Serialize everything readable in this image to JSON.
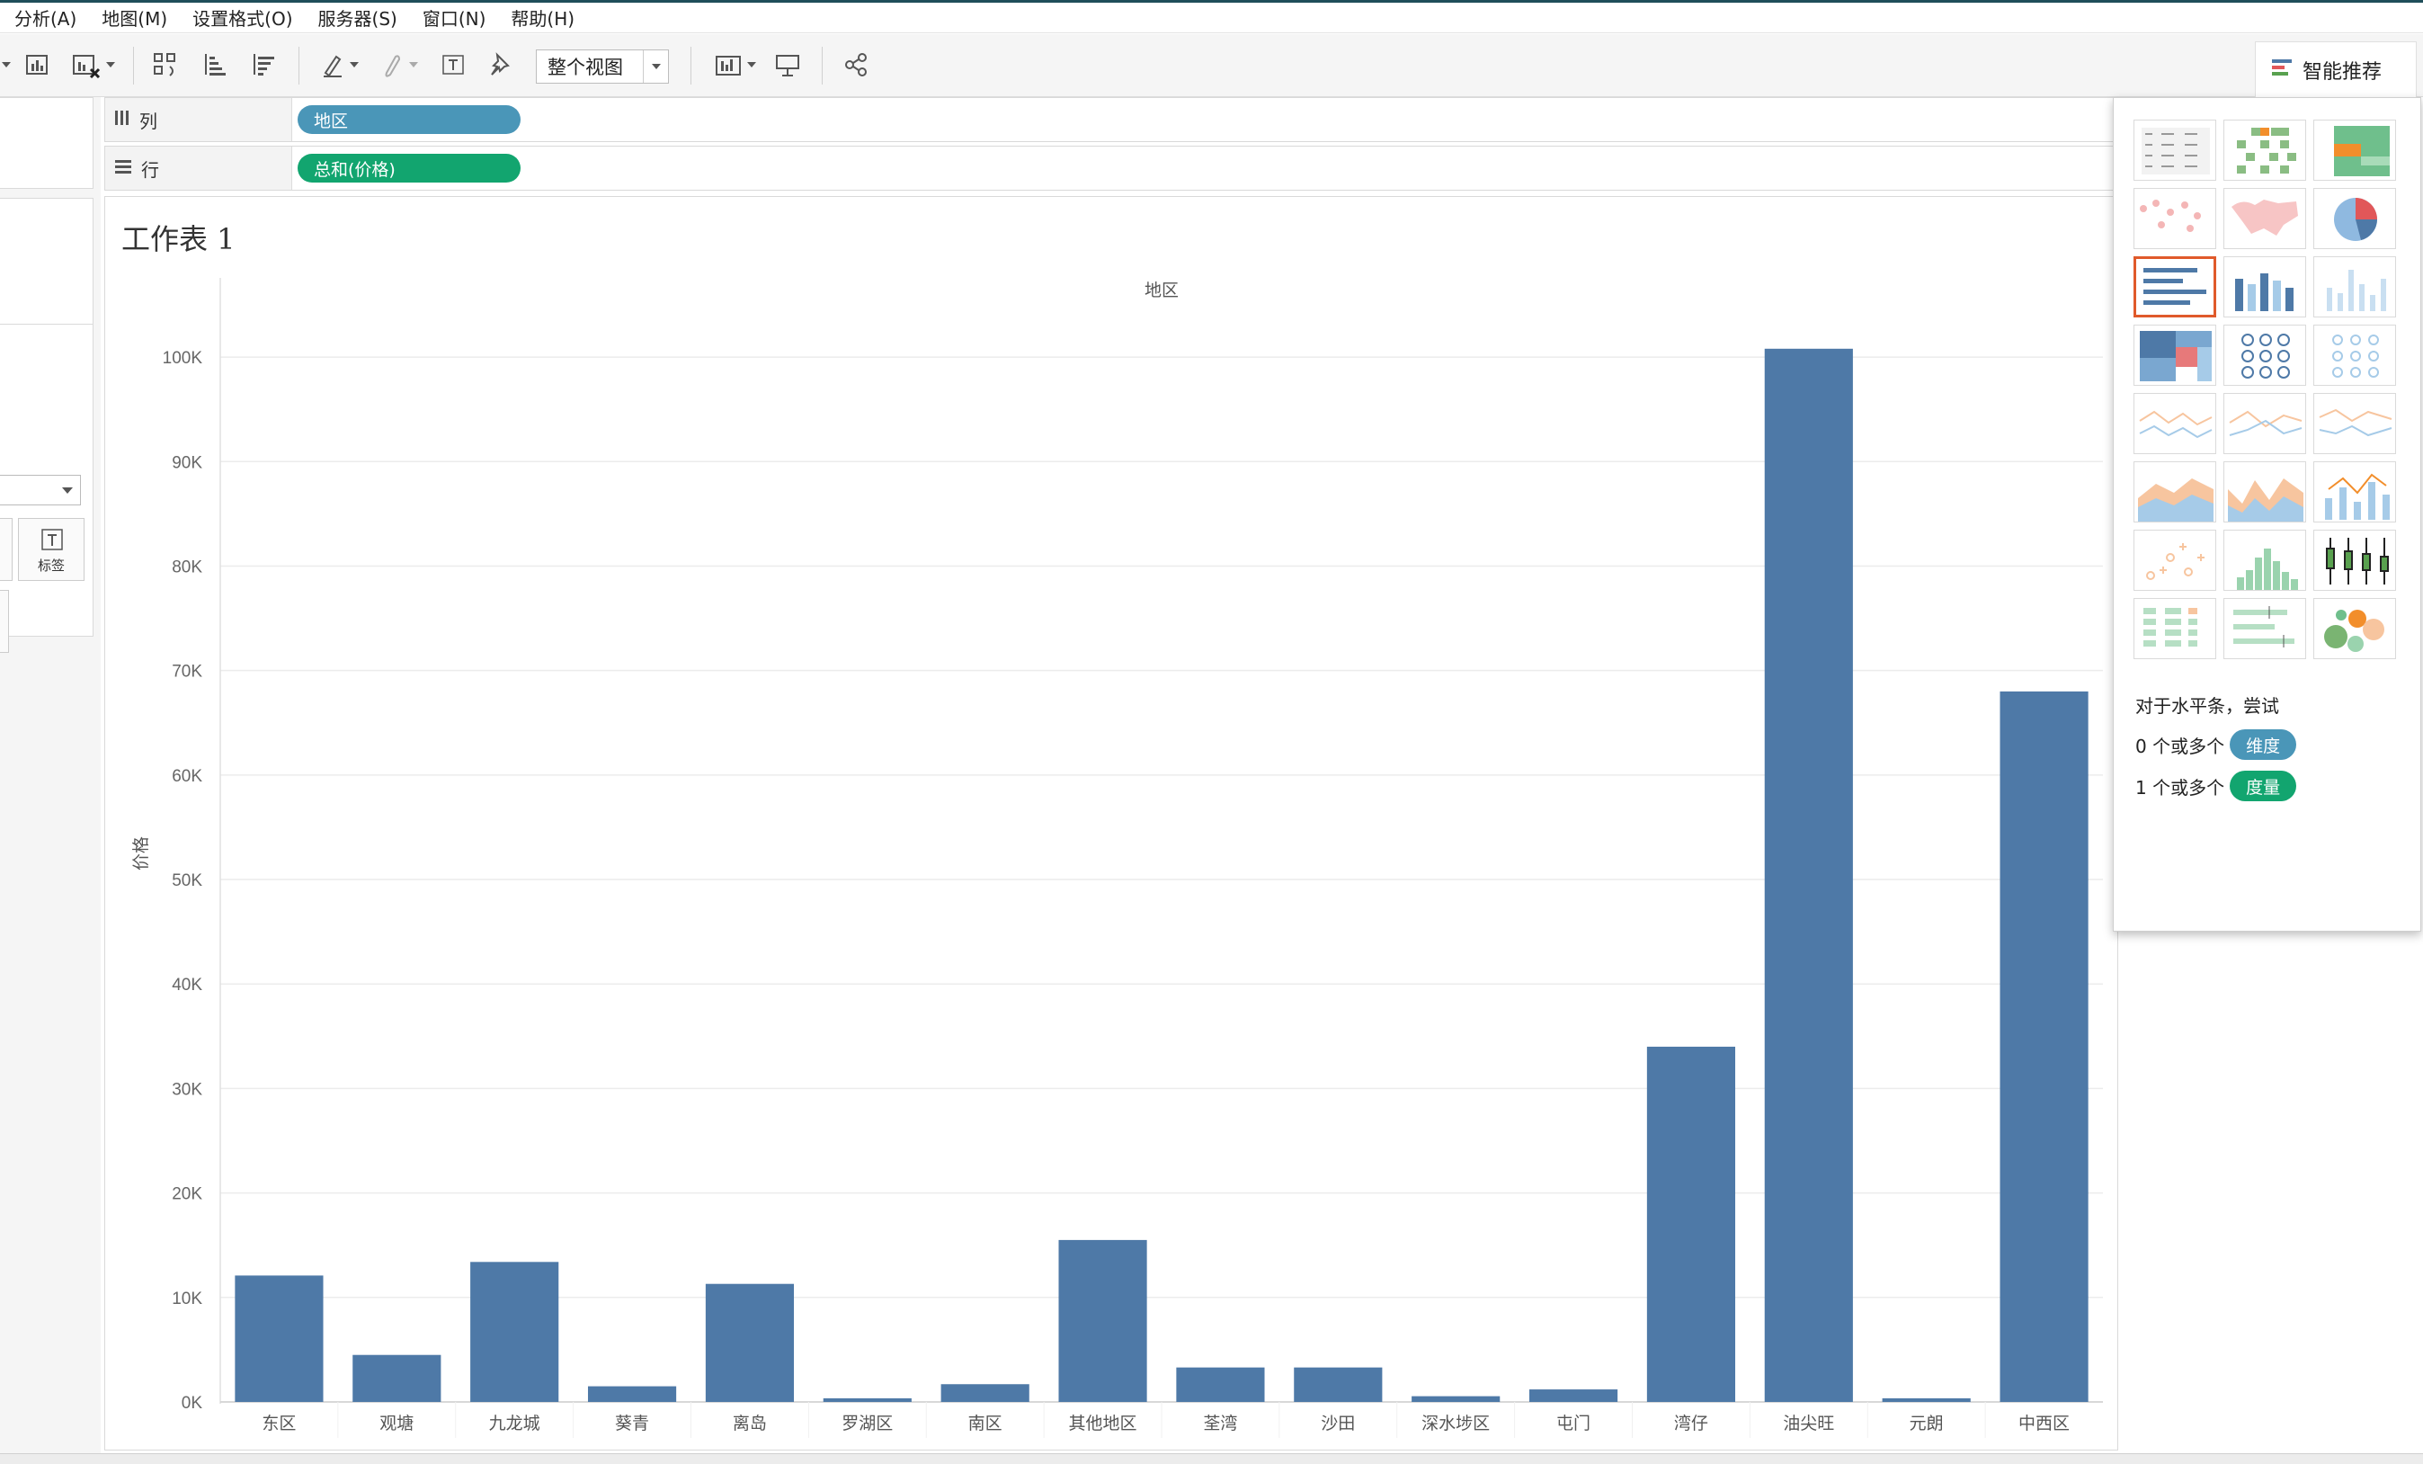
{
  "menu": [
    "分析(A)",
    "地图(M)",
    "设置格式(O)",
    "服务器(S)",
    "窗口(N)",
    "帮助(H)"
  ],
  "toolbar": {
    "view_select": "整个视图",
    "smart_button": "智能推荐"
  },
  "left_panel": {
    "label_button": "标签"
  },
  "shelves": {
    "columns_label": "列",
    "columns_pill": "地区",
    "rows_label": "行",
    "rows_pill": "总和(价格)"
  },
  "sheet": {
    "title": "工作表 1"
  },
  "smart_panel": {
    "hint_title": "对于水平条，尝试",
    "dim_prefix": "0 个或多个",
    "dim_tag": "维度",
    "mea_prefix": "1 个或多个",
    "mea_tag": "度量"
  },
  "colors": {
    "bar": "#4e79a7",
    "dimension_pill": "#4a96b8",
    "measure_pill": "#12a56f",
    "selected_thumb": "#e05a2b"
  },
  "chart_data": {
    "type": "bar",
    "title": "地区",
    "xlabel": "",
    "ylabel": "价格",
    "categories": [
      "东区",
      "观塘",
      "九龙城",
      "葵青",
      "离岛",
      "罗湖区",
      "南区",
      "其他地区",
      "荃湾",
      "沙田",
      "深水埗区",
      "屯门",
      "湾仔",
      "油尖旺",
      "元朗",
      "中西区"
    ],
    "values": [
      12100,
      4500,
      13400,
      1500,
      11300,
      350,
      1700,
      15500,
      3300,
      3300,
      550,
      1200,
      34000,
      100800,
      350,
      68000
    ],
    "ylim": [
      0,
      105000
    ],
    "ticks": [
      0,
      10000,
      20000,
      30000,
      40000,
      50000,
      60000,
      70000,
      80000,
      90000,
      100000
    ],
    "tick_labels": [
      "0K",
      "10K",
      "20K",
      "30K",
      "40K",
      "50K",
      "60K",
      "70K",
      "80K",
      "90K",
      "100K"
    ],
    "grid": true,
    "color": "#4e79a7"
  }
}
